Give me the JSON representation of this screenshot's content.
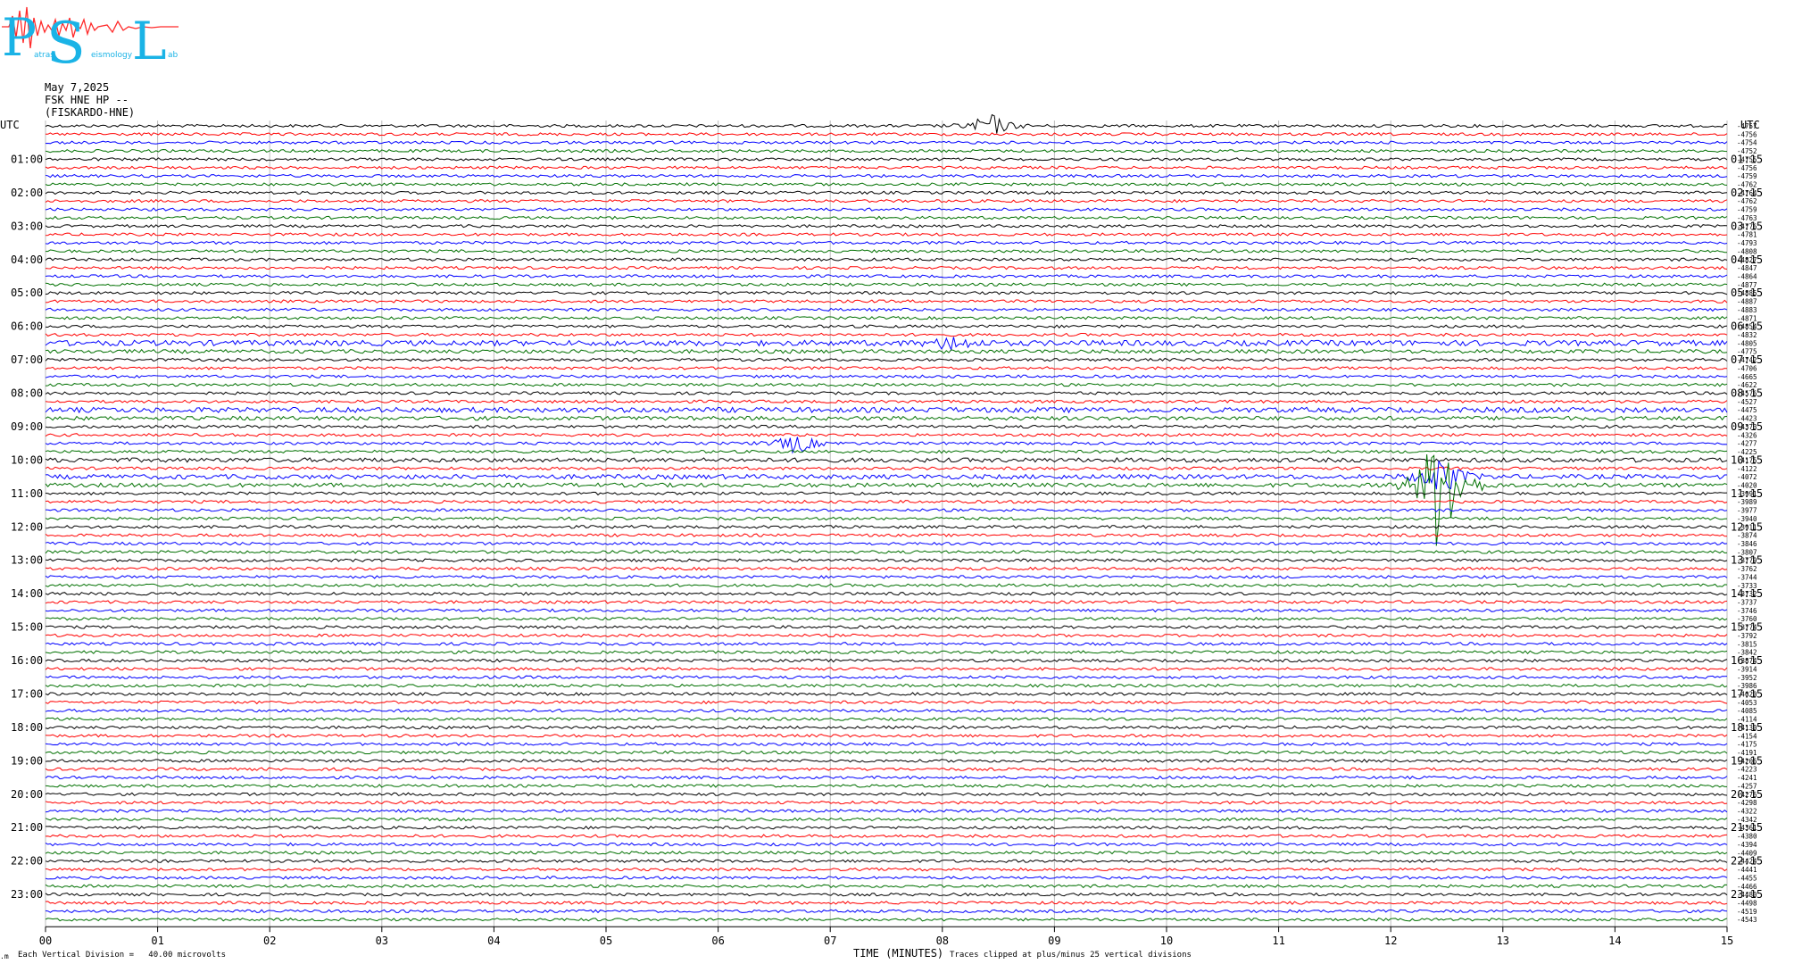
{
  "logo": {
    "letters": [
      "P",
      "S",
      "L"
    ],
    "subtext": [
      "atras",
      "eismology",
      "ab"
    ],
    "colors": {
      "letters": "#1ab3e6",
      "waveform": "#ff2a2a"
    }
  },
  "header": {
    "date": "May 7,2025",
    "station": "FSK HNE HP --",
    "site": "(FISKARDO-HNE)"
  },
  "footer": {
    "left_marker": ".m",
    "scale_text": "Each Vertical Division =   40.00 microvolts",
    "xlabel": "TIME (MINUTES)",
    "clip_note": "Traces clipped at plus/minus 25 vertical divisions"
  },
  "chart_data": {
    "type": "line",
    "subtype": "helicorder",
    "xlabel": "TIME (MINUTES)",
    "xlim": [
      0,
      15
    ],
    "x_ticks": [
      "00",
      "01",
      "02",
      "03",
      "04",
      "05",
      "06",
      "07",
      "08",
      "09",
      "10",
      "11",
      "12",
      "13",
      "14",
      "15"
    ],
    "left_axis_label": "UTC",
    "right_axis_label": "UTC",
    "left_hour_labels": [
      "01:00",
      "02:00",
      "03:00",
      "04:00",
      "05:00",
      "06:00",
      "07:00",
      "08:00",
      "09:00",
      "10:00",
      "11:00",
      "12:00",
      "13:00",
      "14:00",
      "15:00",
      "16:00",
      "17:00",
      "18:00",
      "19:00",
      "20:00",
      "21:00",
      "22:00",
      "23:00"
    ],
    "right_hour_labels": [
      "01:15",
      "02:15",
      "03:15",
      "04:15",
      "05:15",
      "06:15",
      "07:15",
      "08:15",
      "09:15",
      "10:15",
      "11:15",
      "12:15",
      "13:15",
      "14:15",
      "15:15",
      "16:15",
      "17:15",
      "18:15",
      "19:15",
      "20:15",
      "21:15",
      "22:15",
      "23:15"
    ],
    "trace_colors": [
      "#000000",
      "#ff0000",
      "#0000ff",
      "#007000"
    ],
    "lines_per_hour": 4,
    "minutes_per_line": 15,
    "total_lines": 96,
    "trace_offsets": [
      -4757,
      -4756,
      -4754,
      -4752,
      -4755,
      -4756,
      -4759,
      -4762,
      -4764,
      -4762,
      -4759,
      -4763,
      -4776,
      -4781,
      -4793,
      -4808,
      -4827,
      -4847,
      -4864,
      -4877,
      -4885,
      -4887,
      -4883,
      -4871,
      -4854,
      -4832,
      -4805,
      -4775,
      -4742,
      -4706,
      -4665,
      -4622,
      -4576,
      -4527,
      -4475,
      -4423,
      -4373,
      -4326,
      -4277,
      -4225,
      -4175,
      -4122,
      -4072,
      -4020,
      -3991,
      -3989,
      -3977,
      -3940,
      -3911,
      -3874,
      -3846,
      -3807,
      -3779,
      -3762,
      -3744,
      -3733,
      -3732,
      -3737,
      -3746,
      -3760,
      -3774,
      -3792,
      -3815,
      -3842,
      -3874,
      -3914,
      -3952,
      -3986,
      -4020,
      -4053,
      -4085,
      -4114,
      -4130,
      -4154,
      -4175,
      -4191,
      -4206,
      -4223,
      -4241,
      -4257,
      -4276,
      -4298,
      -4322,
      -4342,
      -4361,
      -4380,
      -4394,
      -4409,
      -4424,
      -4441,
      -4455,
      -4466,
      -4480,
      -4498,
      -4519,
      -4543
    ],
    "events": [
      {
        "line": 0,
        "minute": 8.42,
        "amplitude": 1.0
      },
      {
        "line": 26,
        "minute": 8.1,
        "amplitude": 0.6
      },
      {
        "line": 43,
        "minute": 12.45,
        "amplitude": 6.5
      },
      {
        "line": 38,
        "minute": 6.7,
        "amplitude": 0.8
      },
      {
        "line": 42,
        "minute": 12.45,
        "amplitude": 1.6
      }
    ]
  }
}
